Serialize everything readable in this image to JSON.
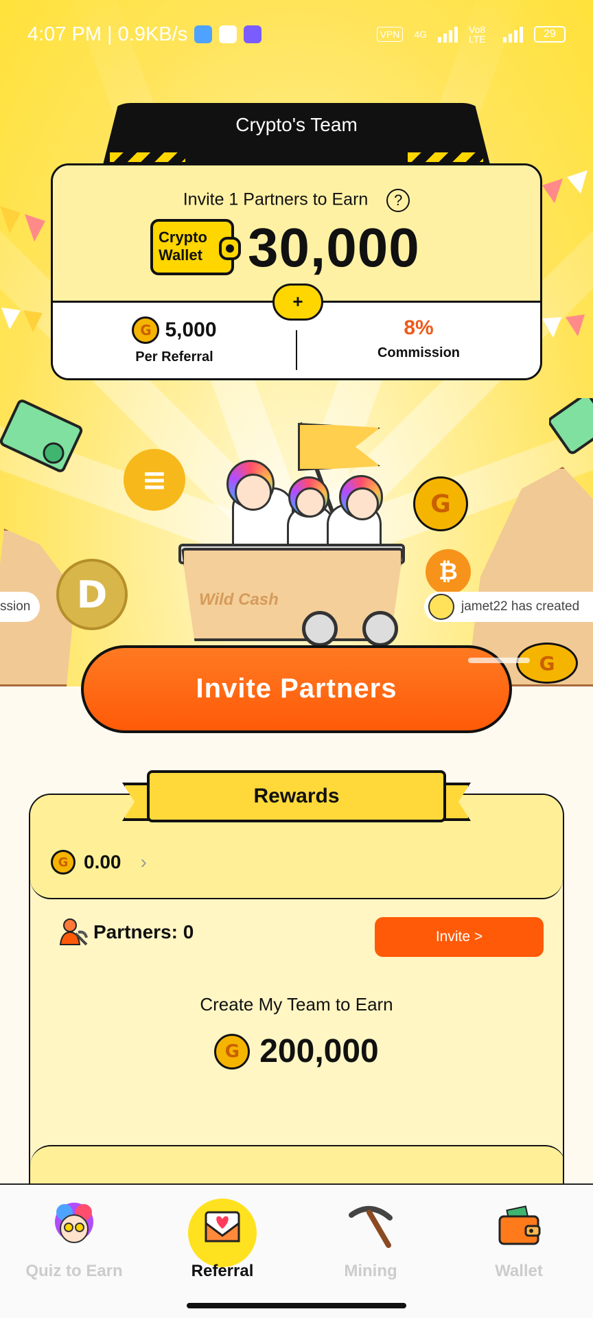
{
  "status_bar": {
    "time_speed": "4:07 PM | 0.9KB/s",
    "vpn": "VPN",
    "network_1": "4G",
    "network_2": "Vo8 LTE",
    "battery": "29"
  },
  "team": {
    "title": "Crypto's Team"
  },
  "invite_card": {
    "title": "Invite 1 Partners to Earn",
    "help": "?",
    "wallet_line1": "Crypto",
    "wallet_line2": "Wallet",
    "amount": "30,000",
    "plus": "+",
    "per_referral_value": "5,000",
    "per_referral_label": "Per Referral",
    "commission_value": "8%",
    "commission_label": "Commission"
  },
  "scene": {
    "cart_label": "Wild Cash",
    "ticker_left": "ssion",
    "ticker_right": "jamet22 has created"
  },
  "cta": {
    "label": "Invite Partners"
  },
  "rewards": {
    "title": "Rewards",
    "balance": "0.00",
    "partners_label": "Partners: 0",
    "invite_button": "Invite >",
    "team_earn_label": "Create My Team to Earn",
    "team_earn_amount": "200,000"
  },
  "nav": {
    "items": [
      {
        "label": "Quiz to Earn",
        "icon": "quiz-avatar-icon",
        "active": false
      },
      {
        "label": "Referral",
        "icon": "heart-envelope-icon",
        "active": true
      },
      {
        "label": "Mining",
        "icon": "pickaxe-icon",
        "active": false
      },
      {
        "label": "Wallet",
        "icon": "wallet-icon",
        "active": false
      }
    ]
  },
  "colors": {
    "primary_yellow": "#ffe23a",
    "accent_orange": "#ff5a08",
    "card_bg": "#fff6c4"
  }
}
